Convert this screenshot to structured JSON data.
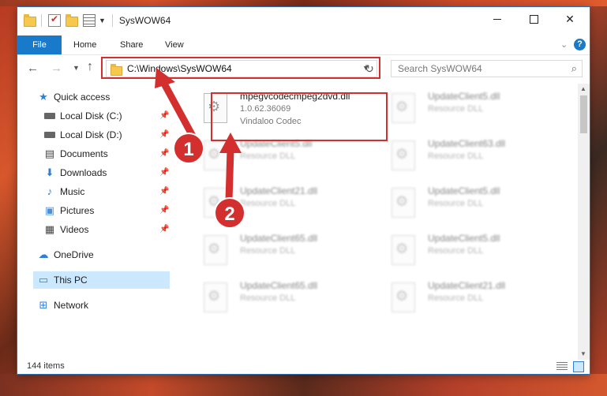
{
  "window": {
    "title": "SysWOW64",
    "colors": {
      "accent": "#1979ca",
      "highlight": "#d32f2f",
      "selected": "#cce8ff"
    }
  },
  "ribbon": {
    "tabs": [
      "File",
      "Home",
      "Share",
      "View"
    ],
    "help": "?"
  },
  "address": {
    "path": "C:\\Windows\\SysWOW64"
  },
  "search": {
    "placeholder": "Search SysWOW64"
  },
  "sidebar": {
    "items": [
      {
        "label": "Quick access",
        "icon": "star-icon"
      },
      {
        "label": "Local Disk (C:)",
        "icon": "disk-icon"
      },
      {
        "label": "Local Disk (D:)",
        "icon": "disk-icon"
      },
      {
        "label": "Documents",
        "icon": "documents-icon"
      },
      {
        "label": "Downloads",
        "icon": "downloads-icon"
      },
      {
        "label": "Music",
        "icon": "music-icon"
      },
      {
        "label": "Pictures",
        "icon": "pictures-icon"
      },
      {
        "label": "Videos",
        "icon": "videos-icon"
      },
      {
        "label": "OneDrive",
        "icon": "cloud-icon"
      },
      {
        "label": "This PC",
        "icon": "computer-icon"
      },
      {
        "label": "Network",
        "icon": "network-icon"
      }
    ]
  },
  "files": {
    "highlighted": {
      "name": "mpegvcodecmpeg2dvd.dll",
      "version": "1.0.62.36069",
      "company": "Vindaloo Codec"
    },
    "left": [
      {
        "name": "UpdateClient5.dll",
        "type": "Resource DLL"
      },
      {
        "name": "UpdateClient21.dll",
        "type": "Resource DLL"
      },
      {
        "name": "UpdateClient65.dll",
        "type": "Resource DLL"
      },
      {
        "name": "UpdateClient65.dll",
        "type": "Resource DLL"
      }
    ],
    "right": [
      {
        "name": "UpdateClient5.dll",
        "type": "Resource DLL"
      },
      {
        "name": "UpdateClient63.dll",
        "type": "Resource DLL"
      },
      {
        "name": "UpdateClient5.dll",
        "type": "Resource DLL"
      },
      {
        "name": "UpdateClient5.dll",
        "type": "Resource DLL"
      },
      {
        "name": "UpdateClient21.dll",
        "type": "Resource DLL"
      }
    ]
  },
  "status": {
    "count": "144 items"
  },
  "callouts": [
    "1",
    "2"
  ]
}
